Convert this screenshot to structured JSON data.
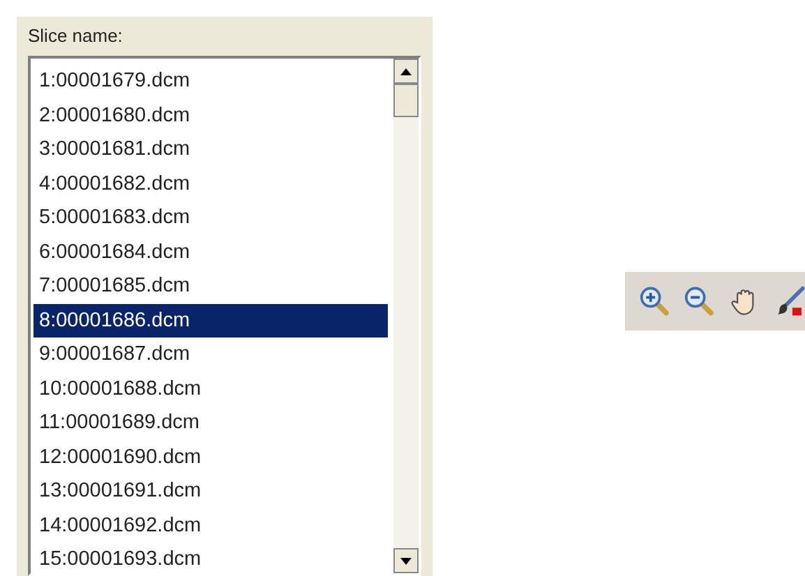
{
  "slice_panel": {
    "label": "Slice name:",
    "items": [
      {
        "text": "1:00001679.dcm",
        "selected": false
      },
      {
        "text": "2:00001680.dcm",
        "selected": false
      },
      {
        "text": "3:00001681.dcm",
        "selected": false
      },
      {
        "text": "4:00001682.dcm",
        "selected": false
      },
      {
        "text": "5:00001683.dcm",
        "selected": false
      },
      {
        "text": "6:00001684.dcm",
        "selected": false
      },
      {
        "text": "7:00001685.dcm",
        "selected": false
      },
      {
        "text": "8:00001686.dcm",
        "selected": true
      },
      {
        "text": "9:00001687.dcm",
        "selected": false
      },
      {
        "text": "10:00001688.dcm",
        "selected": false
      },
      {
        "text": "11:00001689.dcm",
        "selected": false
      },
      {
        "text": "12:00001690.dcm",
        "selected": false
      },
      {
        "text": "13:00001691.dcm",
        "selected": false
      },
      {
        "text": "14:00001692.dcm",
        "selected": false
      },
      {
        "text": "15:00001693.dcm",
        "selected": false
      }
    ]
  },
  "toolbar": {
    "tools": [
      {
        "kind": "zoom-in"
      },
      {
        "kind": "zoom-out"
      },
      {
        "kind": "pan"
      },
      {
        "kind": "draw"
      }
    ]
  }
}
